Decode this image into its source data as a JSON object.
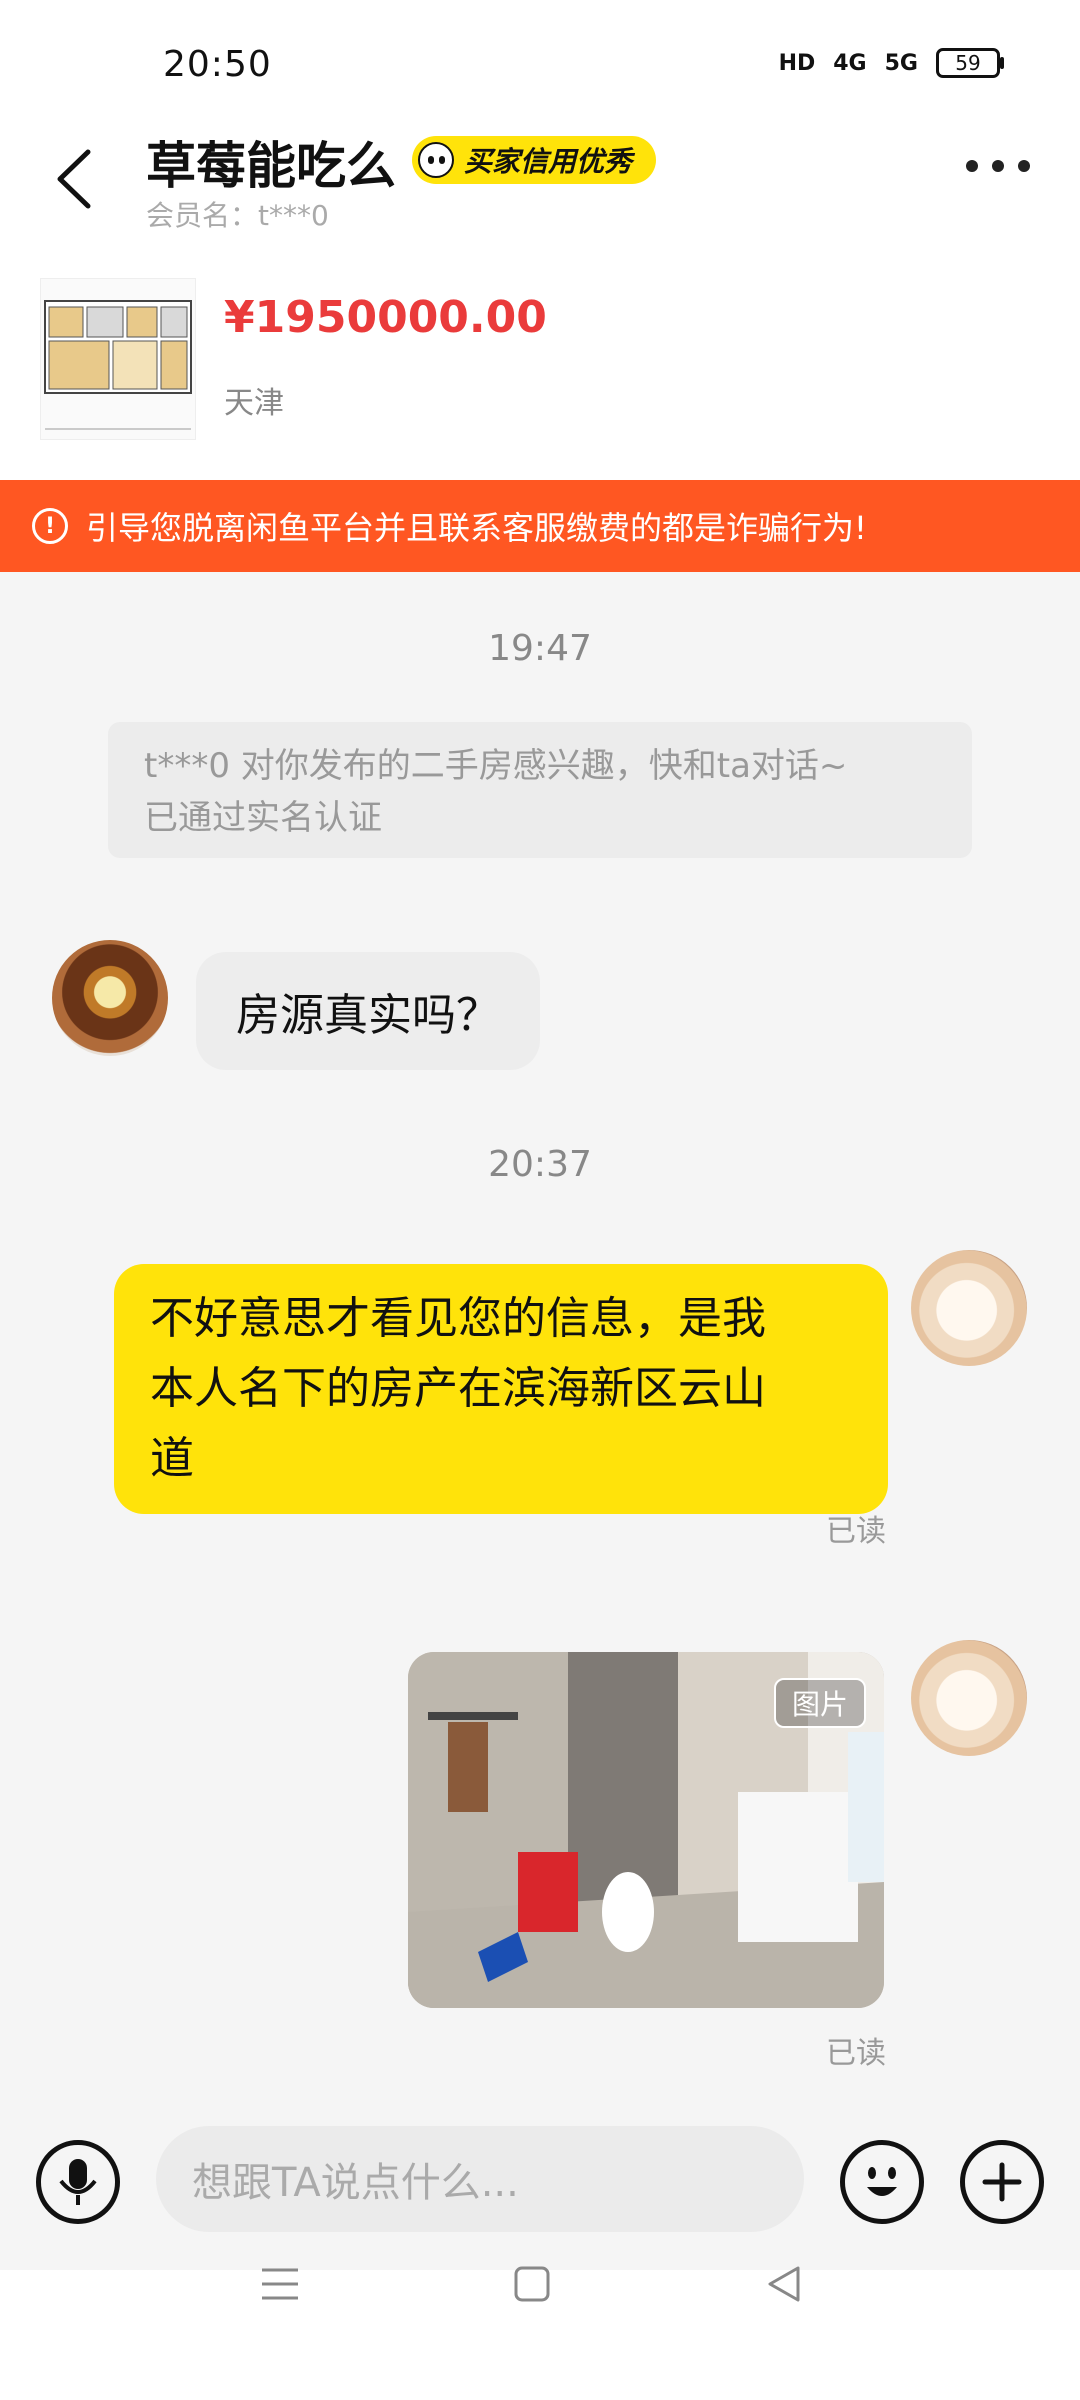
{
  "status_bar": {
    "time": "20:50",
    "hd": "HD",
    "sig1": "4G",
    "sig2": "5G",
    "battery": "59"
  },
  "header": {
    "title": "草莓能吃么",
    "badge": "买家信用优秀",
    "member": "会员名：t***0"
  },
  "product": {
    "price": "¥1950000.00",
    "city": "天津"
  },
  "warning": "引导您脱离闲鱼平台并且联系客服缴费的都是诈骗行为!",
  "chat": {
    "ts1": "19:47",
    "system_line1": "t***0 对你发布的二手房感兴趣，快和ta对话~",
    "system_line2": "已通过实名认证",
    "msg1": "房源真实吗？",
    "ts2": "20:37",
    "msg2_line1": "不好意思才看见您的信息，是我",
    "msg2_line2": "本人名下的房产在滨海新区云山",
    "msg2_line3": "道",
    "read1": "已读",
    "photo_tag": "图片",
    "read2": "已读"
  },
  "input": {
    "placeholder": "想跟TA说点什么..."
  },
  "colors": {
    "accent_yellow": "#ffe30a",
    "warning_orange": "#ff5722",
    "price_red": "#ea3b3b"
  }
}
